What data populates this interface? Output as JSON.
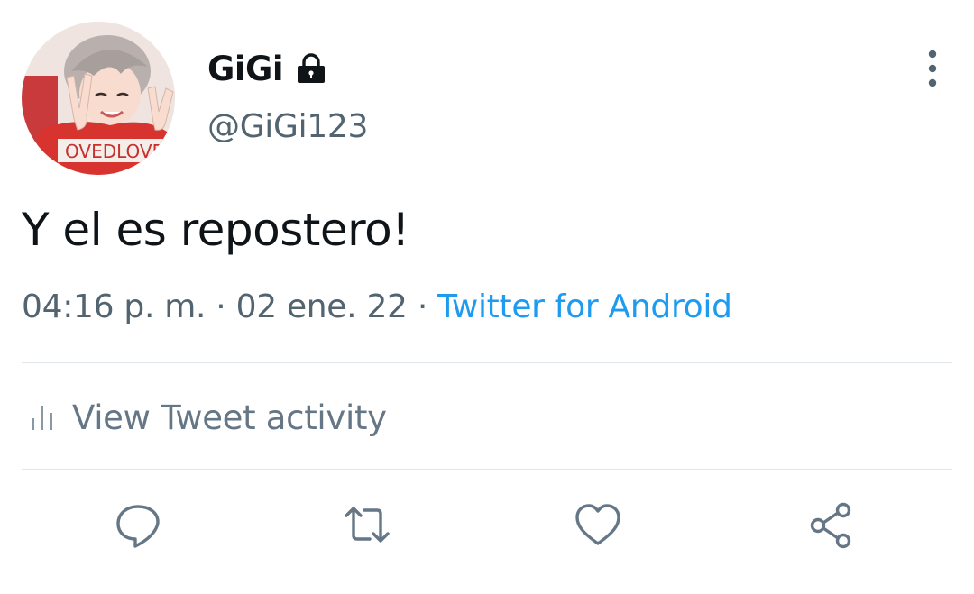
{
  "author": {
    "display_name": "GiGi",
    "handle": "@GiGi123",
    "protected_icon": "lock-icon"
  },
  "tweet": {
    "text": "Y el es repostero!",
    "time": "04:16 p. m.",
    "separator": "·",
    "date": "02 ene. 22",
    "source": "Twitter for Android"
  },
  "activity": {
    "label": "View Tweet activity",
    "icon": "bar-chart-icon"
  },
  "actions": [
    {
      "name": "reply",
      "icon": "comment-icon"
    },
    {
      "name": "retweet",
      "icon": "retweet-icon"
    },
    {
      "name": "like",
      "icon": "heart-icon"
    },
    {
      "name": "share",
      "icon": "share-icon"
    }
  ],
  "colors": {
    "text_primary": "#0f1419",
    "text_secondary": "#536471",
    "link": "#1d9bf0",
    "icon": "#657786",
    "divider": "#e1e6ea"
  }
}
